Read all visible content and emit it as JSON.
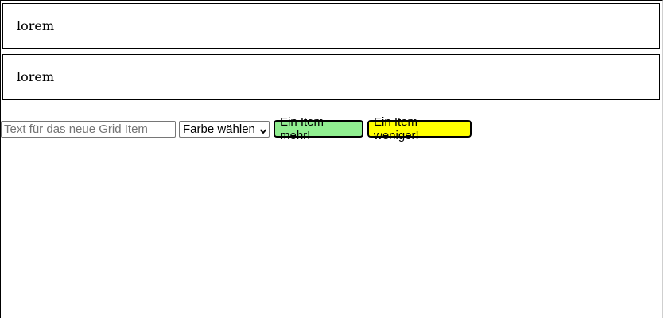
{
  "grid_items": [
    {
      "text": "lorem"
    },
    {
      "text": "lorem"
    }
  ],
  "controls": {
    "text_input": {
      "value": "",
      "placeholder": "Text für das neue Grid Item"
    },
    "color_select": {
      "selected": "Farbe wählen"
    },
    "add_button": {
      "label": "Ein Item mehr!",
      "color": "#90ee90"
    },
    "remove_button": {
      "label": "Ein Item weniger!",
      "color": "#ffff00"
    }
  },
  "icons": {
    "select_arrow": "chevron-down-icon"
  }
}
